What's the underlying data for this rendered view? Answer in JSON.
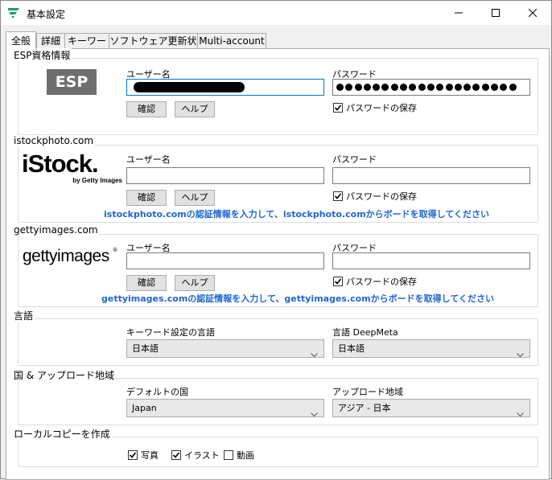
{
  "window": {
    "title": "基本設定",
    "accent": "#1e9b6e"
  },
  "tabs": [
    {
      "label": "全般",
      "active": true
    },
    {
      "label": "詳細"
    },
    {
      "label": "キーワード"
    },
    {
      "label": "ソフトウェア更新状況"
    },
    {
      "label": "Multi-account"
    }
  ],
  "esp": {
    "group_label": "ESP資格情報",
    "logo_text": "ESP",
    "username_label": "ユーザー名",
    "password_label": "パスワード",
    "confirm_label": "確認",
    "help_label": "ヘルプ",
    "save_password_label": "パスワードの保存",
    "save_password_checked": true,
    "password_masked": true
  },
  "istock": {
    "group_label": "istockphoto.com",
    "logo_main": "iStock.",
    "logo_sub": "by Getty Images",
    "username_label": "ユーザー名",
    "password_label": "パスワード",
    "confirm_label": "確認",
    "help_label": "ヘルプ",
    "save_password_label": "パスワードの保存",
    "save_password_checked": true,
    "note": "istockphoto.comの認証情報を入力して、istockphoto.comからボードを取得してください"
  },
  "getty": {
    "group_label": "gettyimages.com",
    "logo_text": "gettyimages",
    "username_label": "ユーザー名",
    "password_label": "パスワード",
    "confirm_label": "確認",
    "help_label": "ヘルプ",
    "save_password_label": "パスワードの保存",
    "save_password_checked": true,
    "note": "gettyimages.comの認証情報を入力して、gettyimages.comからボードを取得してください"
  },
  "language": {
    "group_label": "言語",
    "keyword_lang_label": "キーワード設定の言語",
    "keyword_lang_value": "日本語",
    "deepmeta_lang_label": "言語 DeepMeta",
    "deepmeta_lang_value": "日本語"
  },
  "region": {
    "group_label": "国 & アップロード地域",
    "default_country_label": "デフォルトの国",
    "default_country_value": "Japan",
    "upload_region_label": "アップロード地域",
    "upload_region_value": "アジア - 日本"
  },
  "local_copy": {
    "group_label": "ローカルコピーを作成",
    "options": [
      {
        "label": "写真",
        "checked": true
      },
      {
        "label": "イラスト",
        "checked": true
      },
      {
        "label": "動画",
        "checked": false
      }
    ]
  },
  "note_color": "#1f66d1"
}
